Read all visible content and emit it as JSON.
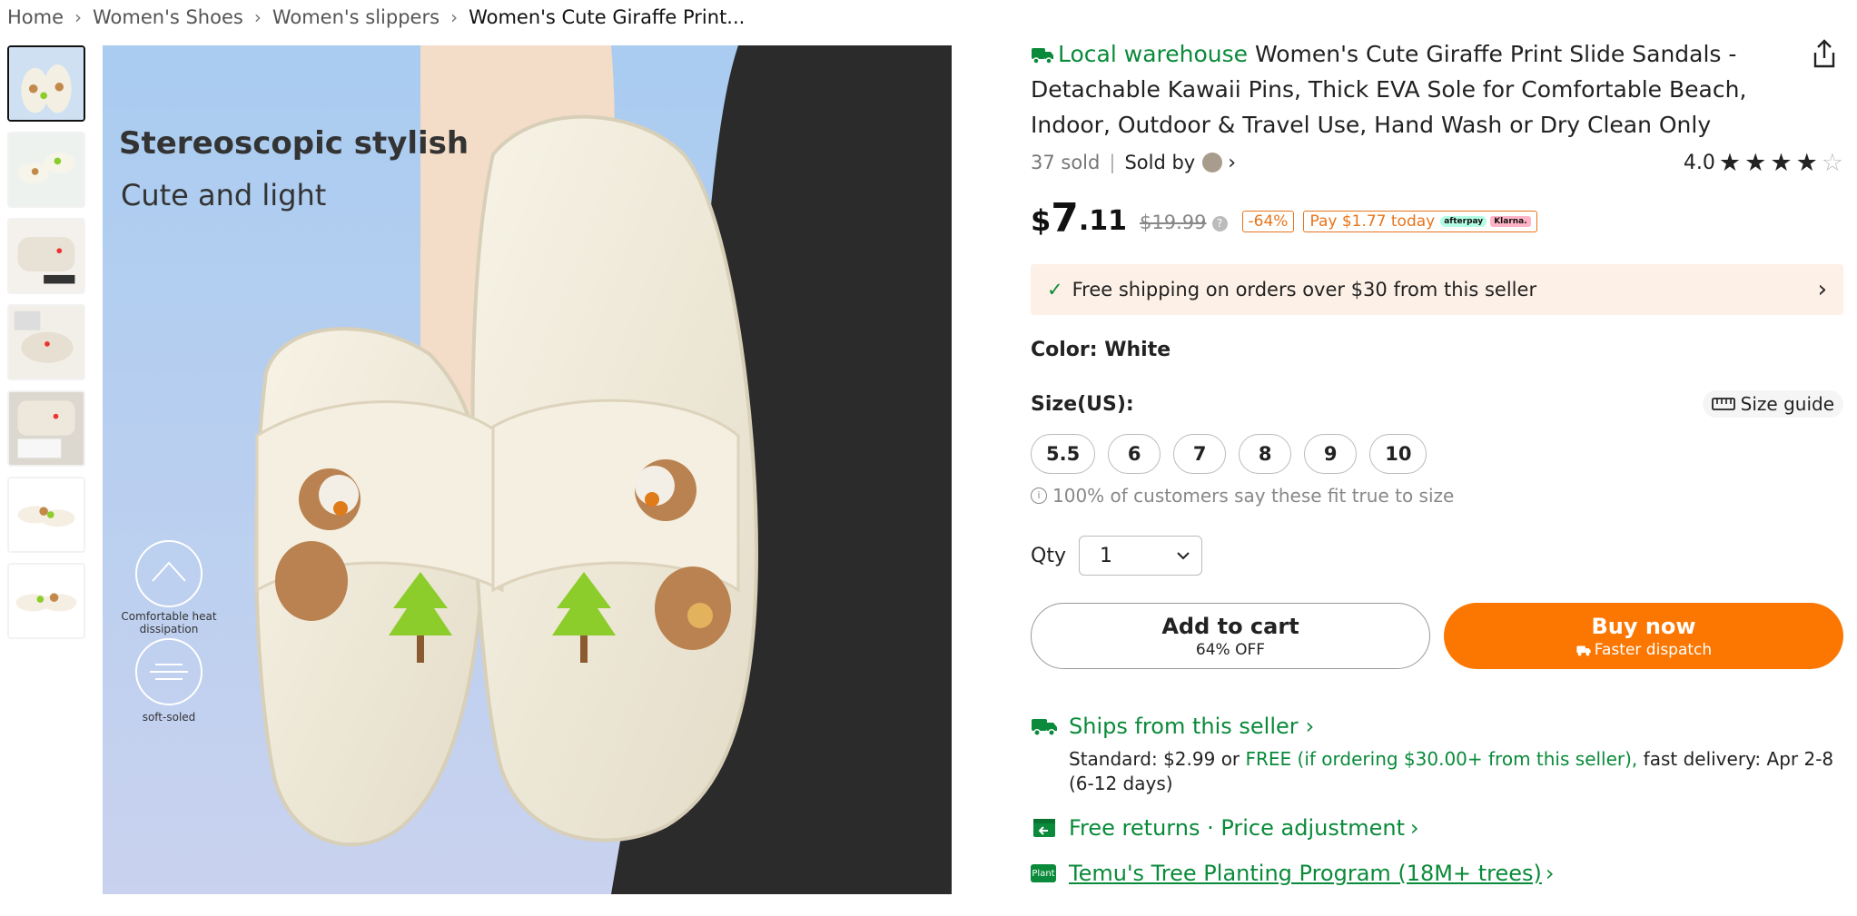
{
  "breadcrumb": {
    "items": [
      "Home",
      "Women's Shoes",
      "Women's slippers"
    ],
    "current": "Women's Cute Giraffe Print..."
  },
  "image": {
    "heading": "Stereoscopic stylish",
    "subheading": "Cute and light",
    "feature1": "Comfortable heat dissipation",
    "feature2": "soft-soled"
  },
  "product": {
    "badge": "Local warehouse",
    "title": "Women's Cute Giraffe Print Slide Sandals - Detachable Kawaii Pins, Thick EVA Sole for Comfortable Beach, Indoor, Outdoor & Travel Use, Hand Wash or Dry Clean Only",
    "sold": "37 sold",
    "sold_by": "Sold by",
    "rating": "4.0",
    "rating_value": 4,
    "rating_max": 5
  },
  "price": {
    "currency": "$",
    "integer": "7",
    "decimal": ".11",
    "original": "$19.99",
    "discount": "-64%",
    "pay_today": "Pay $1.77 today",
    "afterpay": "afterpay",
    "klarna": "Klarna."
  },
  "shipping_banner": "Free shipping on orders over $30 from this seller",
  "color": {
    "label": "Color: White"
  },
  "size": {
    "label": "Size(US):",
    "guide": "Size guide",
    "options": [
      "5.5",
      "6",
      "7",
      "8",
      "9",
      "10"
    ],
    "fit_note": "100% of customers say these fit true to size"
  },
  "qty": {
    "label": "Qty",
    "value": "1"
  },
  "buttons": {
    "add_to_cart": "Add to cart",
    "add_to_cart_sub": "64% OFF",
    "buy_now": "Buy now",
    "buy_now_sub": "Faster dispatch"
  },
  "ships": {
    "title": "Ships from this seller",
    "detail_a": "Standard: $2.99 or ",
    "detail_free": "FREE (if ordering $30.00+ from this seller),",
    "detail_b": " fast delivery: Apr 2-8 (6-12 days)"
  },
  "returns": "Free returns · Price adjustment",
  "tree": {
    "icon_label": "Plant",
    "text": "Temu's Tree Planting Program (18M+ trees)"
  },
  "colors": {
    "accent_orange": "#fb7701",
    "green": "#0a8a3a",
    "banner_bg": "#fdf0e6"
  }
}
